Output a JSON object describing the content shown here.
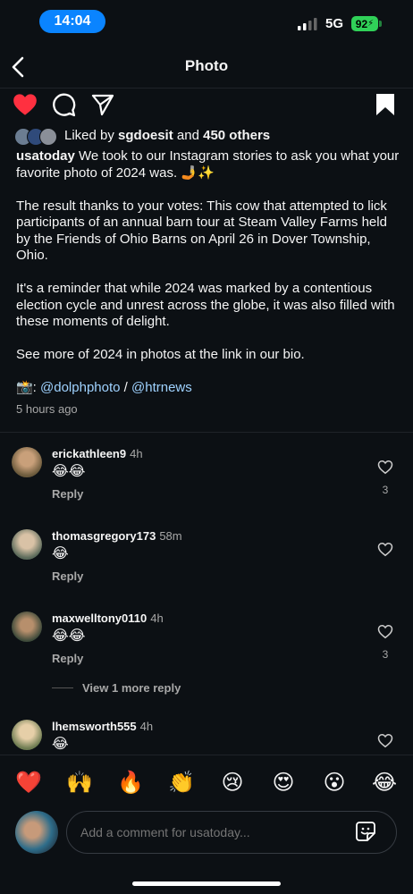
{
  "status": {
    "time": "14:04",
    "network": "5G",
    "battery": "92"
  },
  "nav": {
    "title": "Photo"
  },
  "likes": {
    "prefix": "Liked by ",
    "user": "sgdoesit",
    "middle": " and ",
    "others": "450 others"
  },
  "caption": {
    "user": "usatoday",
    "line1": " We took to our Instagram stories to ask you what your favorite photo of 2024 was. 🤳✨",
    "para2": "The result thanks to your votes: This cow that attempted to lick participants of an annual barn tour at Steam Valley Farms held by the Friends of Ohio Barns on April 26 in Dover Township, Ohio.",
    "para3": "It's a reminder that while 2024 was marked by a contentious election cycle and unrest across the globe, it was also filled with these moments of delight.",
    "para4": "See more of 2024 in photos at the link in our bio.",
    "credit_emoji": "📸: ",
    "credit_link1": "@dolphphoto",
    "credit_sep": " / ",
    "credit_link2": "@htrnews"
  },
  "time_ago": "5 hours ago",
  "comments": [
    {
      "user": "erickathleen9",
      "time": "4h",
      "text": "😂😂",
      "reply": "Reply",
      "likes": "3"
    },
    {
      "user": "thomasgregory173",
      "time": "58m",
      "text": "😂",
      "reply": "Reply",
      "likes": ""
    },
    {
      "user": "maxwelltony0110",
      "time": "4h",
      "text": "😂😂",
      "reply": "Reply",
      "likes": "3"
    },
    {
      "user": "lhemsworth555",
      "time": "4h",
      "text": "😂",
      "reply": "",
      "likes": ""
    }
  ],
  "view_more": "View 1 more reply",
  "emojis": [
    "❤️",
    "🙌",
    "🔥",
    "👏",
    "😢",
    "😍",
    "😮",
    "😂"
  ],
  "comment_box": {
    "placeholder": "Add a comment for usatoday..."
  },
  "colors": {
    "background": "#0c1014",
    "accent": "#0a84ff",
    "like_red": "#ff3040",
    "battery": "#30d158"
  }
}
